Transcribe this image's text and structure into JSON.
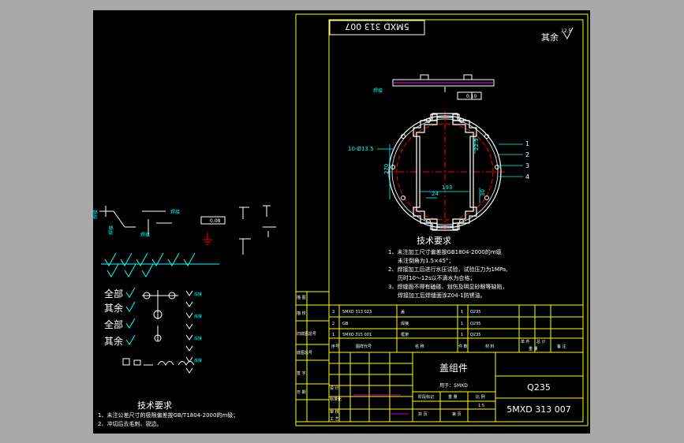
{
  "title_block": {
    "part_name": "盖组件",
    "material": "Q235",
    "drawing_no": "5MXD 313 007",
    "drawing_no_mirror": "5MXD 313 007",
    "used_on": "用于：5MXD",
    "scale": "1:5",
    "side_labels": [
      "描 图",
      "描 校",
      "旧底图总号",
      "底图总号",
      "签 字",
      "日 期"
    ],
    "bom_headers": [
      "序号",
      "图样代号",
      "名 称",
      "件 数",
      "材 料",
      "单 件",
      "总 计",
      "重 量",
      "备 注"
    ],
    "bom_rows": [
      {
        "no": "3",
        "code": "5MXD 313 023",
        "name": "盖",
        "qty": "1",
        "material": "Q235"
      },
      {
        "no": "2",
        "code": "GB",
        "name": "焊接",
        "qty": "1",
        "material": "Q235"
      },
      {
        "no": "1",
        "code": "5MXD 315 001",
        "name": "框架",
        "qty": "1",
        "material": "Q235"
      }
    ],
    "sign_labels": [
      "设 计",
      "标准化",
      "审 核",
      "工 艺",
      "阶段标记",
      "重 量",
      "比 例",
      "共 页",
      "第 页"
    ]
  },
  "main_view": {
    "surface_finish": "其余",
    "roughness": "12.5",
    "flatness_value": "0.10",
    "hole_label": "10-Ø13.5",
    "dims": [
      "270",
      "193",
      "24",
      "22.5",
      "30"
    ],
    "leaders": [
      "1",
      "2",
      "3",
      "4"
    ]
  },
  "tech_main": {
    "heading": "技术要求",
    "lines": [
      "1、未注加工尺寸偏差按GB1804-2000的m级",
      "未注倒角为1.5×45°；",
      "2、焊接加工后进行水压试验，试验压力为1MPa,",
      "历时10～12s以不滴水为合格；",
      "3、焊缝面不得有磕碰、划伤及明显砂眼等缺陷，",
      "焊接加工后焊缝面涂Z04-1防锈油。"
    ]
  },
  "tech_left": {
    "heading": "技术要求",
    "lines": [
      "1、未注公差尺寸的极限偏差按GB/T1804-2000的m级；",
      "2、冲切后去毛刺、锐边。"
    ]
  },
  "symbols": {
    "all_labels": [
      "全部",
      "其余",
      "全部",
      "其余"
    ],
    "tol_value": "0.08"
  },
  "colors": {
    "background": "#000000",
    "frame": "#ffff00",
    "text": "#ffffff",
    "center_line": "#ff0000",
    "annotation": "#00ffff",
    "green": "#00ff00",
    "magenta": "#ff00ff"
  }
}
